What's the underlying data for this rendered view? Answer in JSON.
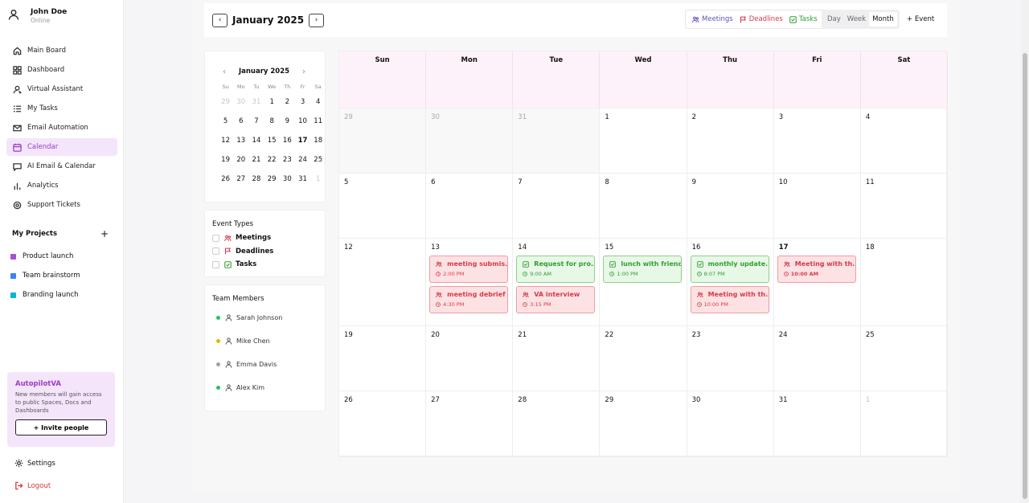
{
  "user": {
    "name": "John Doe",
    "status": "Online"
  },
  "nav": [
    {
      "label": "Main Board",
      "icon": "home-icon"
    },
    {
      "label": "Dashboard",
      "icon": "grid-icon"
    },
    {
      "label": "Virtual Assistant",
      "icon": "assistant-icon"
    },
    {
      "label": "My Tasks",
      "icon": "list-icon"
    },
    {
      "label": "Email Automation",
      "icon": "mail-icon"
    },
    {
      "label": "Calendar",
      "icon": "calendar-icon",
      "active": true
    },
    {
      "label": "AI Email & Calendar",
      "icon": "chat-icon"
    },
    {
      "label": "Analytics",
      "icon": "chart-icon"
    },
    {
      "label": "Support Tickets",
      "icon": "support-icon"
    }
  ],
  "projects": {
    "title": "My Projects",
    "add": "+",
    "items": [
      {
        "label": "Product launch",
        "color": "#a64fd8"
      },
      {
        "label": "Team brainstorm",
        "color": "#3b82f6"
      },
      {
        "label": "Branding launch",
        "color": "#06b6d4"
      }
    ]
  },
  "promo": {
    "title": "AutopilotVA",
    "text": "New members will gain access to public Spaces, Docs and Dashboards",
    "button": "+ Invite people"
  },
  "settings": "Settings",
  "logout": "Logout",
  "header": {
    "prev": "‹",
    "next": "›",
    "title": "January 2025",
    "filters": [
      {
        "label": "Meetings",
        "color": "#5b52c8",
        "icon": "users-icon"
      },
      {
        "label": "Deadlines",
        "color": "#d6394a",
        "icon": "flag-icon"
      },
      {
        "label": "Tasks",
        "color": "#2f9d33",
        "icon": "check-square-icon"
      }
    ],
    "views": [
      "Day",
      "Week",
      "Month"
    ],
    "active_view": "Month",
    "add_event": "+ Event"
  },
  "mini": {
    "title": "January 2025",
    "prev": "‹",
    "next": "›",
    "dow": [
      "Su",
      "Mo",
      "Tu",
      "We",
      "Th",
      "Fr",
      "Sa"
    ],
    "days": [
      [
        "29",
        "30",
        "31",
        "1",
        "2",
        "3",
        "4"
      ],
      [
        "5",
        "6",
        "7",
        "8",
        "9",
        "10",
        "11"
      ],
      [
        "12",
        "13",
        "14",
        "15",
        "16",
        "17",
        "18"
      ],
      [
        "19",
        "20",
        "21",
        "22",
        "23",
        "24",
        "25"
      ],
      [
        "26",
        "27",
        "28",
        "29",
        "30",
        "31",
        "1"
      ]
    ]
  },
  "event_types": {
    "title": "Event Types",
    "items": [
      {
        "label": "Meetings",
        "color": "#d6394a",
        "icon": "users-icon"
      },
      {
        "label": "Deadlines",
        "color": "#d6394a",
        "icon": "flag-icon"
      },
      {
        "label": "Tasks",
        "color": "#2f9d33",
        "icon": "check-square-icon"
      }
    ]
  },
  "team": {
    "title": "Team Members",
    "members": [
      {
        "name": "Sarah Johnson",
        "color": "#22c55e"
      },
      {
        "name": "Mike Chen",
        "color": "#eab308"
      },
      {
        "name": "Emma Davis",
        "color": "#9ca3af"
      },
      {
        "name": "Alex Kim",
        "color": "#22c55e"
      }
    ]
  },
  "calendar": {
    "weekdays": [
      "Sun",
      "Mon",
      "Tue",
      "Wed",
      "Thu",
      "Fri",
      "Sat"
    ],
    "weeks": [
      [
        "29",
        "30",
        "31",
        "1",
        "2",
        "3",
        "4"
      ],
      [
        "5",
        "6",
        "7",
        "8",
        "9",
        "10",
        "11"
      ],
      [
        "12",
        "13",
        "14",
        "15",
        "16",
        "17",
        "18"
      ],
      [
        "19",
        "20",
        "21",
        "22",
        "23",
        "24",
        "25"
      ],
      [
        "26",
        "27",
        "28",
        "29",
        "30",
        "31",
        "1"
      ]
    ],
    "events": [
      {
        "day": "13",
        "title": "meeting submis...",
        "time": "2:00 PM",
        "type": "meeting"
      },
      {
        "day": "13",
        "title": "meeting debrief",
        "time": "4:30 PM",
        "type": "meeting"
      },
      {
        "day": "14",
        "title": "Request for pro...",
        "time": "9:00 AM",
        "type": "task"
      },
      {
        "day": "14",
        "title": "VA interview",
        "time": "3:15 PM",
        "type": "meeting"
      },
      {
        "day": "15",
        "title": "lunch with friends",
        "time": "1:00 PM",
        "type": "task"
      },
      {
        "day": "16",
        "title": "monthly update...",
        "time": "8:07 PM",
        "type": "task"
      },
      {
        "day": "16",
        "title": "Meeting with th...",
        "time": "10:00 PM",
        "type": "meeting"
      },
      {
        "day": "17",
        "title": "Meeting with th...",
        "time": "10:00 AM",
        "type": "meeting"
      }
    ]
  }
}
